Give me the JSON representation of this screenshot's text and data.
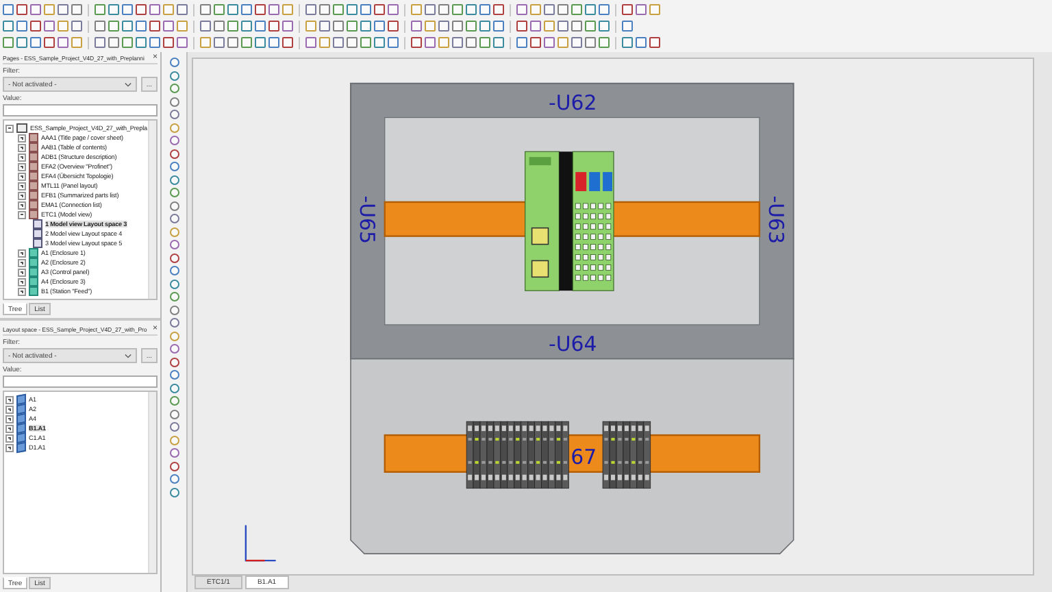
{
  "pages_panel": {
    "title": "Pages - ESS_Sample_Project_V4D_27_with_Preplanni",
    "close": "×",
    "filter_label": "Filter:",
    "filter_value": "- Not activated -",
    "more_button": "...",
    "value_label": "Value:",
    "tree": [
      {
        "label": "ESS_Sample_Project_V4D_27_with_Prepla",
        "kind": "project",
        "expanded": true,
        "selected": false,
        "children": [
          {
            "label": "AAA1 (Title page / cover sheet)",
            "kind": "page",
            "expanded": false,
            "selected": false
          },
          {
            "label": "AAB1 (Table of contents)",
            "kind": "page",
            "expanded": false,
            "selected": false
          },
          {
            "label": "ADB1 (Structure description)",
            "kind": "page",
            "expanded": false,
            "selected": false
          },
          {
            "label": "EFA2 (Overview \"Profinet\")",
            "kind": "page",
            "expanded": false,
            "selected": false
          },
          {
            "label": "EFA4 (Übersicht Topologie)",
            "kind": "page",
            "expanded": false,
            "selected": false
          },
          {
            "label": "MTL11 (Panel layout)",
            "kind": "page",
            "expanded": false,
            "selected": false
          },
          {
            "label": "EFB1 (Summarized parts list)",
            "kind": "page",
            "expanded": false,
            "selected": false
          },
          {
            "label": "EMA1 (Connection list)",
            "kind": "page",
            "expanded": false,
            "selected": false
          },
          {
            "label": "ETC1 (Model view)",
            "kind": "page",
            "expanded": true,
            "selected": false,
            "children": [
              {
                "label": "1 Model view Layout space 3",
                "kind": "view",
                "selected": true
              },
              {
                "label": "2 Model view Layout space 4",
                "kind": "view",
                "selected": false
              },
              {
                "label": "3 Model view Layout space 5",
                "kind": "view",
                "selected": false
              }
            ]
          },
          {
            "label": "A1 (Enclosure 1)",
            "kind": "structure",
            "expanded": false,
            "selected": false
          },
          {
            "label": "A2 (Enclosure 2)",
            "kind": "structure",
            "expanded": false,
            "selected": false
          },
          {
            "label": "A3 (Control panel)",
            "kind": "structure",
            "expanded": false,
            "selected": false
          },
          {
            "label": "A4 (Enclosure 3)",
            "kind": "structure",
            "expanded": false,
            "selected": false
          },
          {
            "label": "B1 (Station \"Feed\")",
            "kind": "structure",
            "expanded": false,
            "selected": false
          }
        ]
      }
    ],
    "tabs": [
      {
        "label": "Tree",
        "selected": true
      },
      {
        "label": "List",
        "selected": false
      }
    ]
  },
  "layout_panel": {
    "title": "Layout space - ESS_Sample_Project_V4D_27_with_Pro",
    "close": "×",
    "filter_label": "Filter:",
    "filter_value": "- Not activated -",
    "more_button": "...",
    "value_label": "Value:",
    "tree": [
      {
        "label": "A1",
        "kind": "layout",
        "expanded": false,
        "selected": false
      },
      {
        "label": "A2",
        "kind": "layout",
        "expanded": false,
        "selected": false
      },
      {
        "label": "A4",
        "kind": "layout",
        "expanded": false,
        "selected": false
      },
      {
        "label": "B1.A1",
        "kind": "layout",
        "expanded": false,
        "selected": true
      },
      {
        "label": "C1.A1",
        "kind": "layout",
        "expanded": false,
        "selected": false
      },
      {
        "label": "D1.A1",
        "kind": "layout",
        "expanded": false,
        "selected": false
      }
    ],
    "tabs": [
      {
        "label": "Tree",
        "selected": true
      },
      {
        "label": "List",
        "selected": false
      }
    ]
  },
  "canvas": {
    "plate_top_label": "-U62",
    "plate_left_label": "-U65",
    "plate_right_label": "-U63",
    "plate_bottom_label": "-U64",
    "rail_label": "67"
  },
  "document_tabs": [
    {
      "label": "ETC1/1",
      "selected": false
    },
    {
      "label": "B1.A1",
      "selected": true
    }
  ]
}
